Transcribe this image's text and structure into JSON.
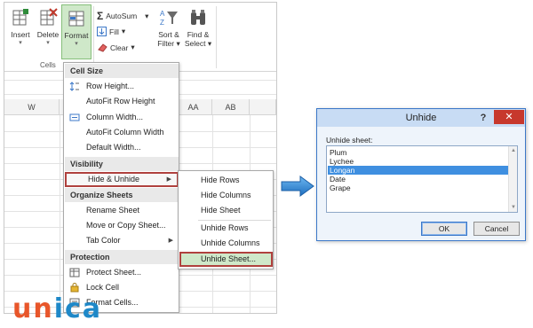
{
  "ribbon": {
    "insert_label": "Insert",
    "delete_label": "Delete",
    "format_label": "Format",
    "cells_group_label": "Cells",
    "autosum_label": "AutoSum",
    "fill_label": "Fill",
    "clear_label": "Clear",
    "sort_filter_label_1": "Sort &",
    "sort_filter_label_2": "Filter",
    "find_select_label_1": "Find &",
    "find_select_label_2": "Select",
    "caret": "▾"
  },
  "grid": {
    "columns": [
      "W",
      "AA",
      "AB"
    ]
  },
  "format_menu": {
    "cell_size_header": "Cell Size",
    "row_height": "Row Height...",
    "autofit_row_height": "AutoFit Row Height",
    "column_width": "Column Width...",
    "autofit_column_width": "AutoFit Column Width",
    "default_width": "Default Width...",
    "visibility_header": "Visibility",
    "hide_unhide": "Hide & Unhide",
    "organize_header": "Organize Sheets",
    "rename_sheet": "Rename Sheet",
    "move_copy_sheet": "Move or Copy Sheet...",
    "tab_color": "Tab Color",
    "protection_header": "Protection",
    "protect_sheet": "Protect Sheet...",
    "lock_cell": "Lock Cell",
    "format_cells": "Format Cells..."
  },
  "submenu": {
    "hide_rows": "Hide Rows",
    "hide_columns": "Hide Columns",
    "hide_sheet": "Hide Sheet",
    "unhide_rows": "Unhide Rows",
    "unhide_columns": "Unhide Columns",
    "unhide_sheet": "Unhide Sheet..."
  },
  "logo": {
    "part1": "un",
    "part2": "ica"
  },
  "dialog": {
    "title": "Unhide",
    "help": "?",
    "close": "✕",
    "label": "Unhide sheet:",
    "sheets": [
      "Plum",
      "Lychee",
      "Longan",
      "Date",
      "Grape"
    ],
    "selected_sheet": "Longan",
    "ok_label": "OK",
    "cancel_label": "Cancel"
  },
  "colors": {
    "highlight_border": "#b0413e",
    "selection_blue": "#3f8fe0",
    "active_green": "#cfe8c9",
    "close_red": "#c7382c",
    "arrow_blue": "#2f86d3"
  }
}
